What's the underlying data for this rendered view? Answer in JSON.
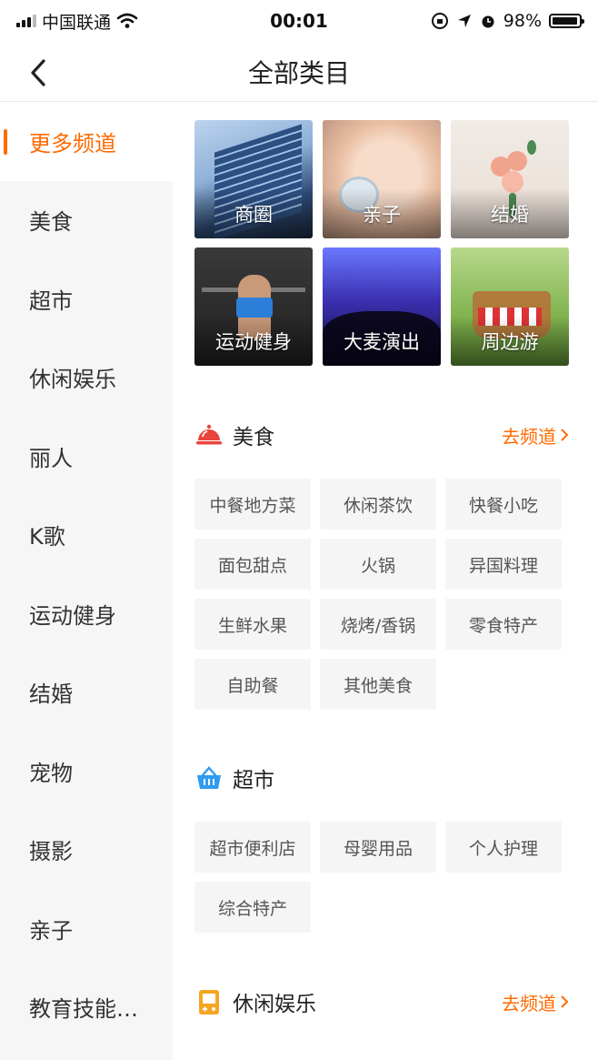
{
  "status_bar": {
    "carrier": "中国联通",
    "time": "00:01",
    "battery_percent": "98%",
    "battery_level": 0.98
  },
  "nav": {
    "title": "全部类目",
    "back_icon": "chevron-left-icon"
  },
  "sidebar": {
    "items": [
      {
        "label": "更多频道",
        "active": true
      },
      {
        "label": "美食"
      },
      {
        "label": "超市"
      },
      {
        "label": "休闲娱乐"
      },
      {
        "label": "丽人"
      },
      {
        "label": "K歌"
      },
      {
        "label": "运动健身"
      },
      {
        "label": "结婚"
      },
      {
        "label": "宠物"
      },
      {
        "label": "摄影"
      },
      {
        "label": "亲子"
      },
      {
        "label": "教育技能…"
      }
    ]
  },
  "channels": [
    {
      "label": "商圈"
    },
    {
      "label": "亲子"
    },
    {
      "label": "结婚"
    },
    {
      "label": "运动健身"
    },
    {
      "label": "大麦演出"
    },
    {
      "label": "周边游"
    }
  ],
  "sections": [
    {
      "title": "美食",
      "icon": "food-cloche-icon",
      "goto_label": "去频道",
      "tags": [
        "中餐地方菜",
        "休闲茶饮",
        "快餐小吃",
        "面包甜点",
        "火锅",
        "异国料理",
        "生鲜水果",
        "烧烤/香锅",
        "零食特产",
        "自助餐",
        "其他美食"
      ]
    },
    {
      "title": "超市",
      "icon": "shopping-basket-icon",
      "tags": [
        "超市便利店",
        "母婴用品",
        "个人护理",
        "综合特产"
      ]
    },
    {
      "title": "休闲娱乐",
      "icon": "game-console-icon",
      "goto_label": "去频道"
    }
  ],
  "colors": {
    "accent": "#ff6a00",
    "food_icon": "#e8453c",
    "market_icon": "#2e9bf0",
    "leisure_icon": "#f5a623"
  }
}
